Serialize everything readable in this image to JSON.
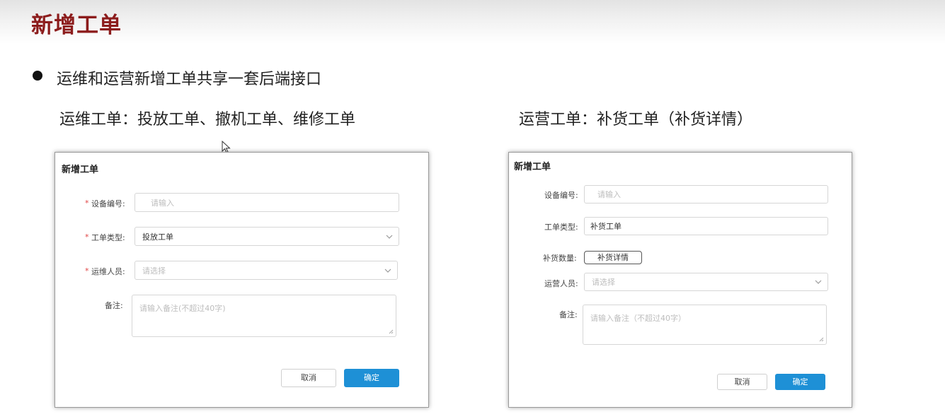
{
  "slide": {
    "title": "新增工单",
    "bullet": "运维和运营新增工单共享一套后端接口",
    "left_heading": "运维工单：投放工单、撤机工单、维修工单",
    "right_heading": "运营工单：补货工单（补货详情）"
  },
  "ops_dialog": {
    "title": "新增工单",
    "required_mark": "*",
    "device_label": "设备编号:",
    "device_placeholder": "请输入",
    "type_label": "工单类型:",
    "type_value": "投放工单",
    "staff_label": "运维人员:",
    "staff_placeholder": "请选择",
    "remark_label": "备注:",
    "remark_placeholder": "请输入备注(不超过40字)",
    "cancel_label": "取消",
    "confirm_label": "确定"
  },
  "biz_dialog": {
    "title": "新增工单",
    "device_label": "设备编号:",
    "device_placeholder": "请输入",
    "type_label": "工单类型:",
    "type_value": "补货工单",
    "qty_label": "补货数量:",
    "detail_button_label": "补货详情",
    "staff_label": "运营人员:",
    "staff_placeholder": "请选择",
    "remark_label": "备注:",
    "remark_placeholder": "请输入备注（不超过40字）",
    "cancel_label": "取消",
    "confirm_label": "确定"
  },
  "colors": {
    "title_red": "#8c1c1c",
    "primary_blue": "#1e90d6",
    "required_red": "#e04545"
  },
  "icons": [
    "chevron-down-icon",
    "resize-grip-icon",
    "mouse-cursor-icon"
  ]
}
